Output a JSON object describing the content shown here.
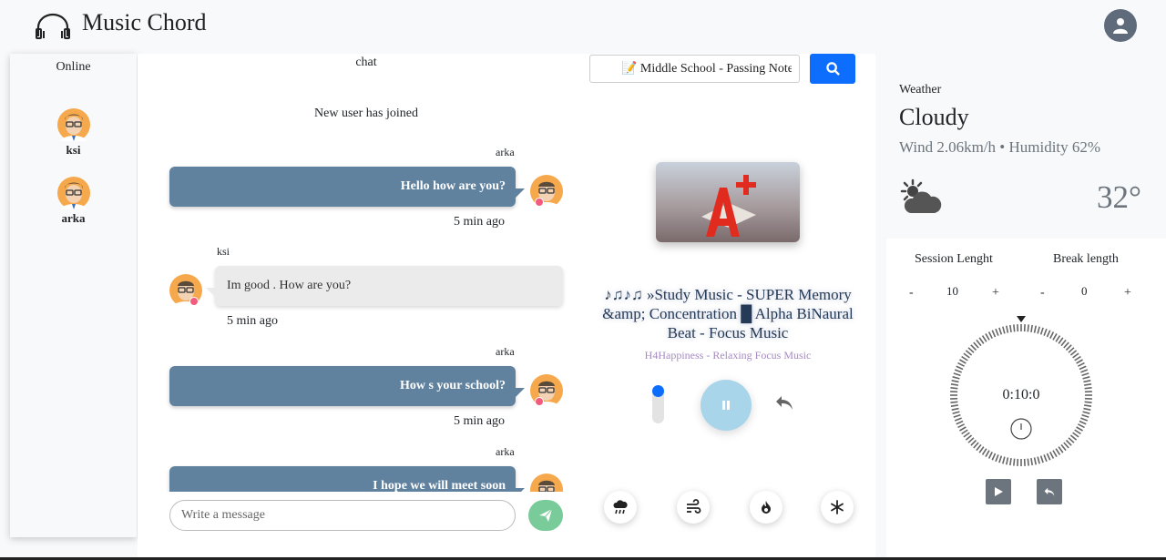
{
  "header": {
    "app_title": "Music Chord",
    "brand_icon": "headphones-icon",
    "user_icon": "user-avatar-icon"
  },
  "online": {
    "title": "Online",
    "users": [
      {
        "name": "ksi"
      },
      {
        "name": "arka"
      }
    ]
  },
  "chat": {
    "title": "chat",
    "system_message": "New user has joined",
    "messages": [
      {
        "sender": "arka",
        "text": "Hello how are you?",
        "time": "5 min ago",
        "side": "right"
      },
      {
        "sender": "ksi",
        "text": "Im good . How are you?",
        "time": "5 min ago",
        "side": "left"
      },
      {
        "sender": "arka",
        "text": "How s your school?",
        "time": "5 min ago",
        "side": "right"
      },
      {
        "sender": "arka",
        "text": "I hope we will meet soon",
        "time": "",
        "side": "right"
      }
    ],
    "input_placeholder": "Write a message",
    "send_icon": "paper-plane-icon"
  },
  "player": {
    "search_value": "📝 Middle School - Passing Notes",
    "search_icon": "search-icon",
    "song_title": "♪♫♪♫ »Study Music - SUPER Memory &amp; Concentration █ Alpha BiNaural Beat - Focus Music",
    "artist": "H4Happiness - Relaxing Focus Music",
    "volume_level": 1.0,
    "state": "playing",
    "ambient_sounds": [
      "rain-cloud-icon",
      "wind-icon",
      "fire-icon",
      "snowflake-icon"
    ]
  },
  "weather": {
    "label": "Weather",
    "condition": "Cloudy",
    "details": "Wind 2.06km/h • Humidity 62%",
    "temperature": "32°",
    "icon": "partly-cloudy-icon"
  },
  "timer": {
    "session_label": "Session Lenght",
    "break_label": "Break length",
    "session_value": "10",
    "break_value": "0",
    "minus": "-",
    "plus": "+",
    "time": "0:10:0"
  },
  "colors": {
    "accent": "#0d6efd",
    "bubble_right": "#61829f",
    "bubble_left": "#ebebeb",
    "send": "#7acb9a",
    "pause": "#a9d5ea"
  }
}
